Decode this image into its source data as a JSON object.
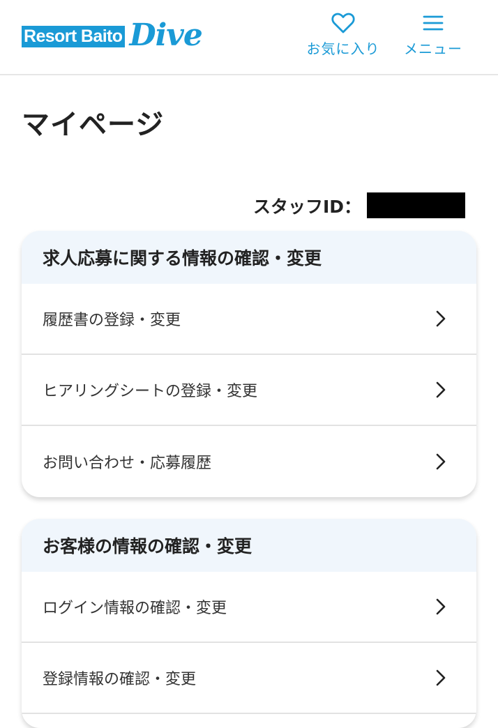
{
  "header": {
    "logo_box": "Resort Baito",
    "logo_script": "Dive",
    "favorites_label": "お気に入り",
    "menu_label": "メニュー",
    "accent_color": "#1a9ad6"
  },
  "page": {
    "title": "マイページ",
    "staff_id_label": "スタッフID："
  },
  "sections": [
    {
      "title": "求人応募に関する情報の確認・変更",
      "items": [
        {
          "label": "履歴書の登録・変更",
          "icon": "chevron-right-icon"
        },
        {
          "label": "ヒアリングシートの登録・変更",
          "icon": "chevron-right-icon"
        },
        {
          "label": "お問い合わせ・応募履歴",
          "icon": "chevron-right-icon"
        }
      ]
    },
    {
      "title": "お客様の情報の確認・変更",
      "items": [
        {
          "label": "ログイン情報の確認・変更",
          "icon": "chevron-right-icon"
        },
        {
          "label": "登録情報の確認・変更",
          "icon": "chevron-right-icon"
        }
      ]
    }
  ]
}
